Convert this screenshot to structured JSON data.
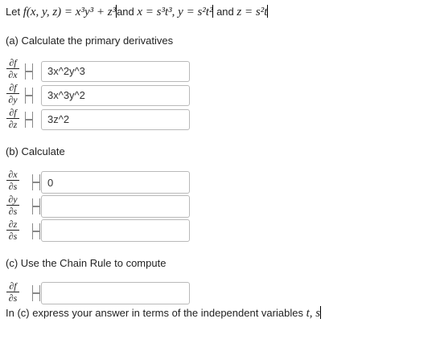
{
  "intro": {
    "prefix": "Let ",
    "f_def": "f(x, y, z) = x³y³ + z³",
    "and1": "and",
    "xy_def": "x = s³t³, y = s²t²",
    "and2": "and",
    "z_def": "z = s²t"
  },
  "part_a": {
    "heading": "(a) Calculate the primary derivatives",
    "rows": [
      {
        "num": "∂f",
        "den": "∂x",
        "value": "3x^2y^3"
      },
      {
        "num": "∂f",
        "den": "∂y",
        "value": "3x^3y^2"
      },
      {
        "num": "∂f",
        "den": "∂z",
        "value": "3z^2"
      }
    ]
  },
  "part_b": {
    "heading": "(b) Calculate",
    "rows": [
      {
        "num": "∂x",
        "den": "∂s",
        "value": "0"
      },
      {
        "num": "∂y",
        "den": "∂s",
        "value": ""
      },
      {
        "num": "∂z",
        "den": "∂s",
        "value": ""
      }
    ]
  },
  "part_c": {
    "heading": "(c) Use the Chain Rule to compute",
    "rows": [
      {
        "num": "∂f",
        "den": "∂s",
        "value": ""
      }
    ]
  },
  "note": {
    "text": "In (c) express your answer in terms of the independent variables ",
    "vars": "t, s"
  }
}
